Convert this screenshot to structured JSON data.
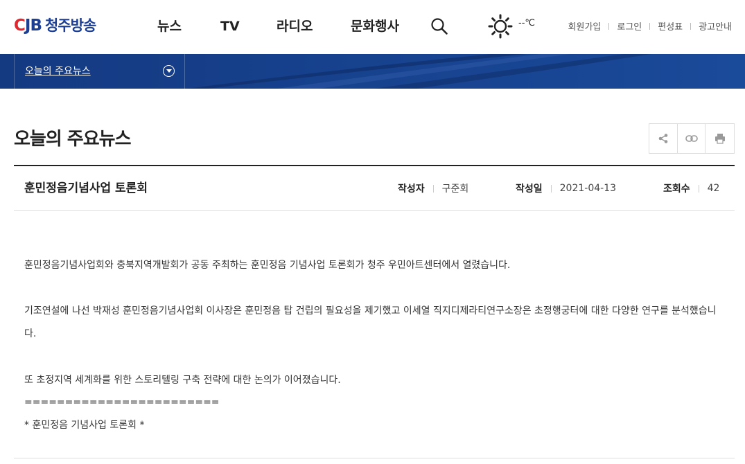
{
  "header": {
    "logo_mark_c": "C",
    "logo_mark_jb": "JB",
    "logo_text": "청주방송",
    "nav": [
      "뉴스",
      "TV",
      "라디오",
      "문화행사"
    ],
    "search_icon": "search-icon",
    "weather_icon": "sun-icon",
    "weather_temp": "--℃",
    "util_links": [
      "회원가입",
      "로그인",
      "편성표",
      "광고안내"
    ]
  },
  "subbar": {
    "current": "오늘의 주요뉴스",
    "toggle_icon": "chevron-down-icon"
  },
  "page": {
    "title": "오늘의 주요뉴스",
    "tools": [
      "share-icon",
      "link-icon",
      "print-icon"
    ]
  },
  "article": {
    "title": "훈민정음기념사업 토론회",
    "author_label": "작성자",
    "author": "구준회",
    "date_label": "작성일",
    "date": "2021-04-13",
    "views_label": "조회수",
    "views": "42",
    "paragraphs": [
      "훈민정음기념사업회와 충북지역개발회가 공동 주최하는 훈민정음 기념사업 토론회가 청주 우민아트센터에서 열렸습니다.",
      "기조연설에 나선 박재성 훈민정음기념사업회 이사장은 훈민정음 탑 건립의 필요성을 제기했고 이세열 직지디제라티연구소장은 초정행궁터에 대한 다양한 연구를 분석했습니다.",
      "또 초정지역 세계화를 위한 스토리텔링 구축 전략에 대한 논의가 이어졌습니다.",
      "========================",
      "* 훈민정음 기념사업 토론회 *"
    ]
  },
  "colors": {
    "brand_blue": "#1c3f94",
    "brand_red": "#e0262e",
    "subbar": "#163f8a"
  }
}
